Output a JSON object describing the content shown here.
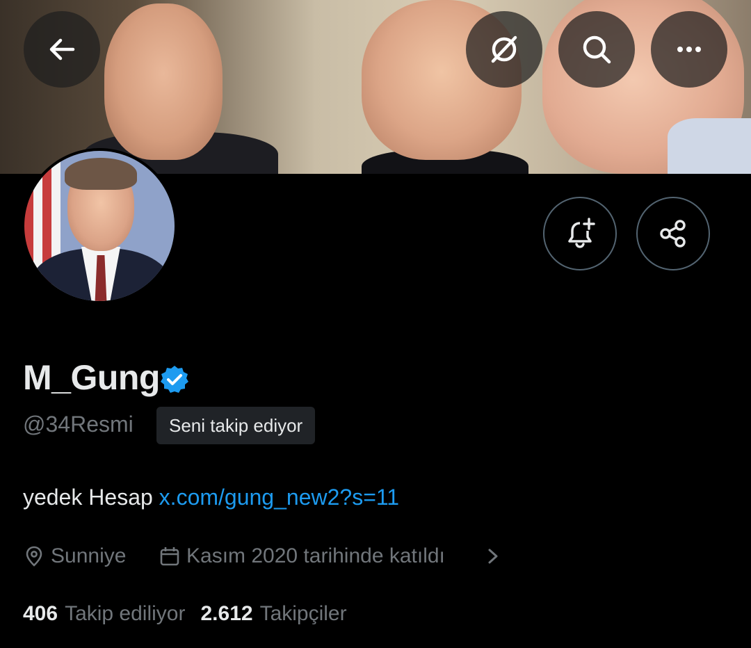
{
  "header": {
    "back_icon": "arrow-left-icon",
    "grok_icon": "grok-icon",
    "search_icon": "search-icon",
    "more_icon": "more-horizontal-icon"
  },
  "profile": {
    "display_name": "M_Gung",
    "verified_icon": "verified-badge-icon",
    "verified_color": "#1d9bf0",
    "handle": "@34Resmi",
    "follows_you_label": "Seni takip ediyor",
    "bio_text": "yedek Hesap ",
    "bio_link": "x.com/gung_new2?s=11",
    "location": "Sunniye",
    "joined": "Kasım 2020 tarihinde katıldı",
    "following_count": "406",
    "following_label": "Takip ediliyor",
    "followers_count": "2.612",
    "followers_label": "Takipçiler"
  },
  "actions": {
    "notify_icon": "bell-plus-icon",
    "share_icon": "share-icon"
  },
  "colors": {
    "background": "#000000",
    "text_primary": "#e7e9ea",
    "text_secondary": "#71767b",
    "link": "#1d9bf0",
    "border": "#536471"
  }
}
